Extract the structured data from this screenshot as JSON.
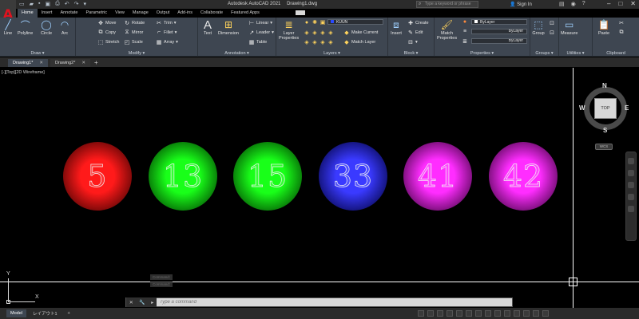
{
  "app": {
    "logo": "A",
    "title": "Autodesk AutoCAD 2021",
    "file_title": "Drawing1.dwg",
    "search_placeholder": "Type a keyword or phrase",
    "sign_in": "Sign In"
  },
  "ribbon_tabs": [
    "Home",
    "Insert",
    "Annotate",
    "Parametric",
    "View",
    "Manage",
    "Output",
    "Add-ins",
    "Collaborate",
    "Featured Apps"
  ],
  "ribbon": {
    "draw": {
      "title": "Draw ▾",
      "line": "Line",
      "polyline": "Polyline",
      "circle": "Circle",
      "arc": "Arc"
    },
    "modify": {
      "title": "Modify ▾",
      "move": "Move",
      "rotate": "Rotate",
      "trim": "Trim",
      "copy": "Copy",
      "mirror": "Mirror",
      "fillet": "Fillet",
      "stretch": "Stretch",
      "scale": "Scale",
      "array": "Array"
    },
    "annotation": {
      "title": "Annotation ▾",
      "text": "Text",
      "dimension": "Dimension",
      "linear": "Linear",
      "leader": "Leader",
      "table": "Table"
    },
    "layers": {
      "title": "Layers ▾",
      "layer_properties_1": "Layer",
      "layer_properties_2": "Properties",
      "layer_name": "KUUN",
      "make_current": "Make Current",
      "match_layer": "Match Layer"
    },
    "block": {
      "title": "Block ▾",
      "insert": "Insert",
      "create": "Create",
      "edit": "Edit"
    },
    "properties": {
      "title": "Properties ▾",
      "match_1": "Match",
      "match_2": "Properties",
      "color": "ByLayer",
      "linetype": "ByLayer",
      "lineweight": "ByLayer"
    },
    "groups": {
      "title": "Groups ▾",
      "group": "Group"
    },
    "utilities": {
      "title": "Utilities ▾",
      "measure": "Measure"
    },
    "clipboard": {
      "title": "Clipboard",
      "paste": "Paste"
    }
  },
  "doc_tabs": [
    {
      "label": "Drawing1*",
      "active": true
    },
    {
      "label": "Drawing2*",
      "active": false
    }
  ],
  "viewport_label": "[-][Top][2D Wireframe]",
  "balls": [
    {
      "number": "5",
      "color": "#ff1a1a",
      "dark": "#3a0000"
    },
    {
      "number": "13",
      "color": "#19ff19",
      "dark": "#003a00"
    },
    {
      "number": "15",
      "color": "#19ff19",
      "dark": "#003a00"
    },
    {
      "number": "33",
      "color": "#3a3aff",
      "dark": "#00003a"
    },
    {
      "number": "41",
      "color": "#ff2dff",
      "dark": "#3a003a"
    },
    {
      "number": "42",
      "color": "#ff2dff",
      "dark": "#3a003a"
    }
  ],
  "viewcube": {
    "top": "TOP",
    "n": "N",
    "s": "S",
    "e": "E",
    "w": "W",
    "wcs": "WCS"
  },
  "ucs": {
    "x": "X",
    "y": "Y"
  },
  "command": {
    "placeholder": "Type a command",
    "history_1": "Command:",
    "history_2": "Command:"
  },
  "layout_tabs": [
    {
      "label": "Model",
      "active": true
    },
    {
      "label": "レイアウト1",
      "active": false
    }
  ],
  "layout_add": "+"
}
